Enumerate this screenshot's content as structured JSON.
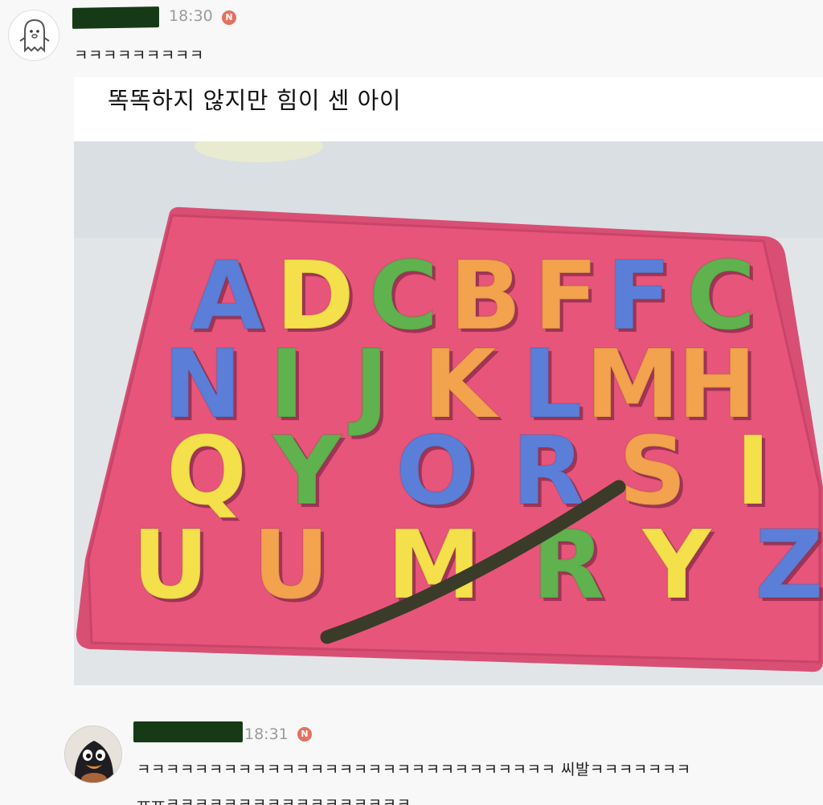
{
  "comments": [
    {
      "time": "18:30",
      "new_badge": "N",
      "text": "ㅋㅋㅋㅋㅋㅋㅋㅋㅋ",
      "attachment": {
        "caption": "똑똑하지 않지만 힘이 센 아이",
        "puzzle": {
          "letters": [
            {
              "char": "A",
              "color": "#5b7fd9"
            },
            {
              "char": "D",
              "color": "#f4e04a"
            },
            {
              "char": "C",
              "color": "#5fb24d"
            },
            {
              "char": "B",
              "color": "#f3a24e"
            },
            {
              "char": "F",
              "color": "#f3a24e"
            },
            {
              "char": "F",
              "color": "#5b7fd9"
            },
            {
              "char": "C",
              "color": "#5fb24d"
            },
            {
              "char": "N",
              "color": "#5b7fd9"
            },
            {
              "char": "I",
              "color": "#5fb24d"
            },
            {
              "char": "J",
              "color": "#5fb24d"
            },
            {
              "char": "K",
              "color": "#f3a24e"
            },
            {
              "char": "L",
              "color": "#5b7fd9"
            },
            {
              "char": "M",
              "color": "#f3a24e"
            },
            {
              "char": "H",
              "color": "#f3a24e"
            },
            {
              "char": "Q",
              "color": "#f4e04a"
            },
            {
              "char": "Y",
              "color": "#5fb24d"
            },
            {
              "char": "O",
              "color": "#5b7fd9"
            },
            {
              "char": "R",
              "color": "#5b7fd9"
            },
            {
              "char": "S",
              "color": "#f3a24e"
            },
            {
              "char": "I",
              "color": "#f4e04a"
            },
            {
              "char": "U",
              "color": "#f4e04a"
            },
            {
              "char": "U",
              "color": "#f3a24e"
            },
            {
              "char": "M",
              "color": "#f4e04a"
            },
            {
              "char": "R",
              "color": "#5fb24d"
            },
            {
              "char": "Y",
              "color": "#f4e04a"
            },
            {
              "char": "Z",
              "color": "#5b7fd9"
            }
          ]
        }
      }
    },
    {
      "time": "18:31",
      "new_badge": "N",
      "text_line1": "ㅋㅋㅋㅋㅋㅋㅋㅋㅋㅋㅋㅋㅋㅋㅋㅋㅋㅋㅋㅋㅋㅋㅋㅋㅋㅋㅋㅋㅋ 씨발ㅋㅋㅋㅋㅋㅋㅋ",
      "text_line2": "ㅠㅠㅋㅋㅋㅋㅋㅋㅋㅋㅋㅋㅋㅋㅋㅋㅋㅋㅋ"
    }
  ],
  "colors": {
    "mat": "#e8557a",
    "redaction": "#163a16",
    "badge": "#e5705f"
  }
}
